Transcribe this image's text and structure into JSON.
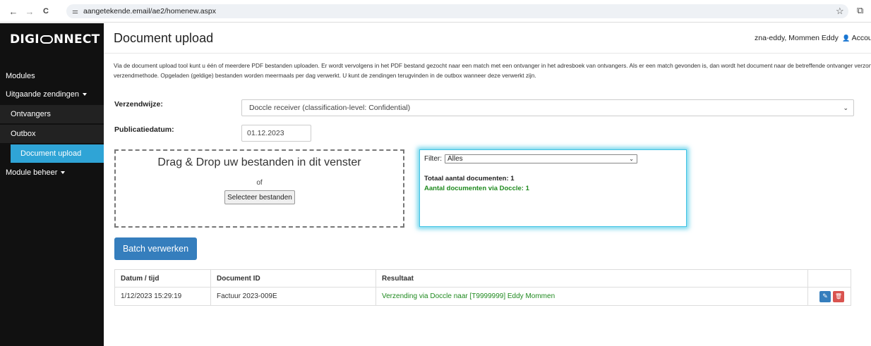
{
  "browser": {
    "url": "aangetekende.email/ae2/homenew.aspx",
    "back_icon": "←",
    "forward_icon": "→",
    "reload_icon": "C",
    "tune_icon": "⚌",
    "star_icon": "☆",
    "extension_icon": "⧉"
  },
  "sidebar": {
    "logo_left": "DIGI",
    "logo_right": "NNECT",
    "items": [
      {
        "label": "Modules"
      },
      {
        "label": "Uitgaande zendingen"
      },
      {
        "label": "Ontvangers"
      },
      {
        "label": "Outbox"
      },
      {
        "label": "Document upload"
      },
      {
        "label": "Module beheer"
      }
    ]
  },
  "header": {
    "title": "Document upload",
    "user": "zna-eddy, Mommen Eddy",
    "account_icon": "👤",
    "account": "Accou"
  },
  "intro": {
    "line1": "Via de document upload tool kunt u één of meerdere PDF bestanden uploaden. Er wordt vervolgens in het PDF bestand gezocht naar een match met een ontvanger in het adresboek van ontvangers. Als er een match gevonden is, dan wordt het document naar de betreffende ontvanger verzonden",
    "line2": "verzendmethode. Opgeladen (geldige) bestanden worden meermaals per dag verwerkt. U kunt de zendingen terugvinden in de outbox wanneer deze verwerkt zijn."
  },
  "form": {
    "verzendwijze_label": "Verzendwijze:",
    "verzendwijze_value": "Doccle receiver (classification-level: Confidential)",
    "publicatiedatum_label": "Publicatiedatum:",
    "publicatiedatum_value": "01.12.2023"
  },
  "dropzone": {
    "title": "Drag & Drop uw bestanden in dit venster",
    "of": "of",
    "button": "Selecteer bestanden"
  },
  "filter": {
    "label": "Filter:",
    "value": "Alles",
    "total": "Totaal aantal documenten: 1",
    "doccle": "Aantal documenten via Doccle: 1"
  },
  "batch_button": "Batch verwerken",
  "table": {
    "headers": [
      "Datum / tijd",
      "Document ID",
      "Resultaat",
      ""
    ],
    "rows": [
      {
        "datum": "1/12/2023 15:29:19",
        "document_id": "Factuur 2023-009E",
        "resultaat": "Verzending via Doccle naar [T9999999] Eddy Mommen",
        "edit_icon": "✎",
        "delete_icon": "🗑"
      }
    ]
  },
  "colors": {
    "sidebar_bg": "#111111",
    "sidebar_active": "#2fa4d6",
    "primary_button": "#357ebd",
    "success_text": "#1f8a1f",
    "delete_button": "#d9534f",
    "filter_glow": "#42c3e4"
  }
}
